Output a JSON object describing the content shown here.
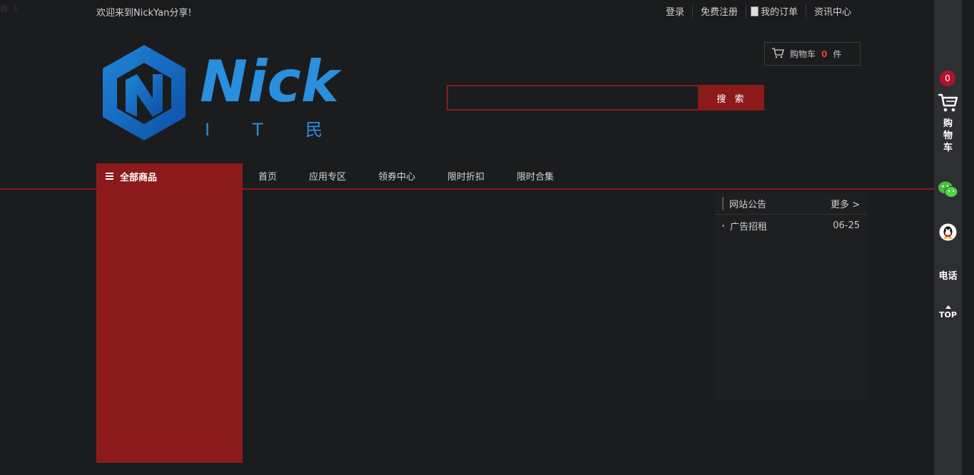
{
  "topbar": {
    "corner_mark": "静 1",
    "welcome": "欢迎来到NickYan分享!",
    "links": {
      "login": "登录",
      "register": "免费注册",
      "orders": "我的订单",
      "news": "资讯中心"
    }
  },
  "logo": {
    "brand": "Nick",
    "tagline": "I T 民 工"
  },
  "cart": {
    "label": "购物车",
    "count": "0",
    "unit": "件"
  },
  "search": {
    "value": "",
    "button_label": "搜 索"
  },
  "nav": {
    "all_goods": "全部商品",
    "items": [
      "首页",
      "应用专区",
      "领券中心",
      "限时折扣",
      "限时合集"
    ]
  },
  "notice": {
    "title": "网站公告",
    "more": "更多 >",
    "items": [
      {
        "title": "广告招租",
        "date": "06-25"
      }
    ]
  },
  "sidebar": {
    "badge_count": "0",
    "cart_label_1": "购",
    "cart_label_2": "物",
    "cart_label_3": "车",
    "phone_label": "电话",
    "top_label": "TOP"
  },
  "colors": {
    "accent": "#8c1a1a",
    "background": "#1b1c1e",
    "logo_blue": "#2a8fdc",
    "badge_red": "#b0122e"
  }
}
